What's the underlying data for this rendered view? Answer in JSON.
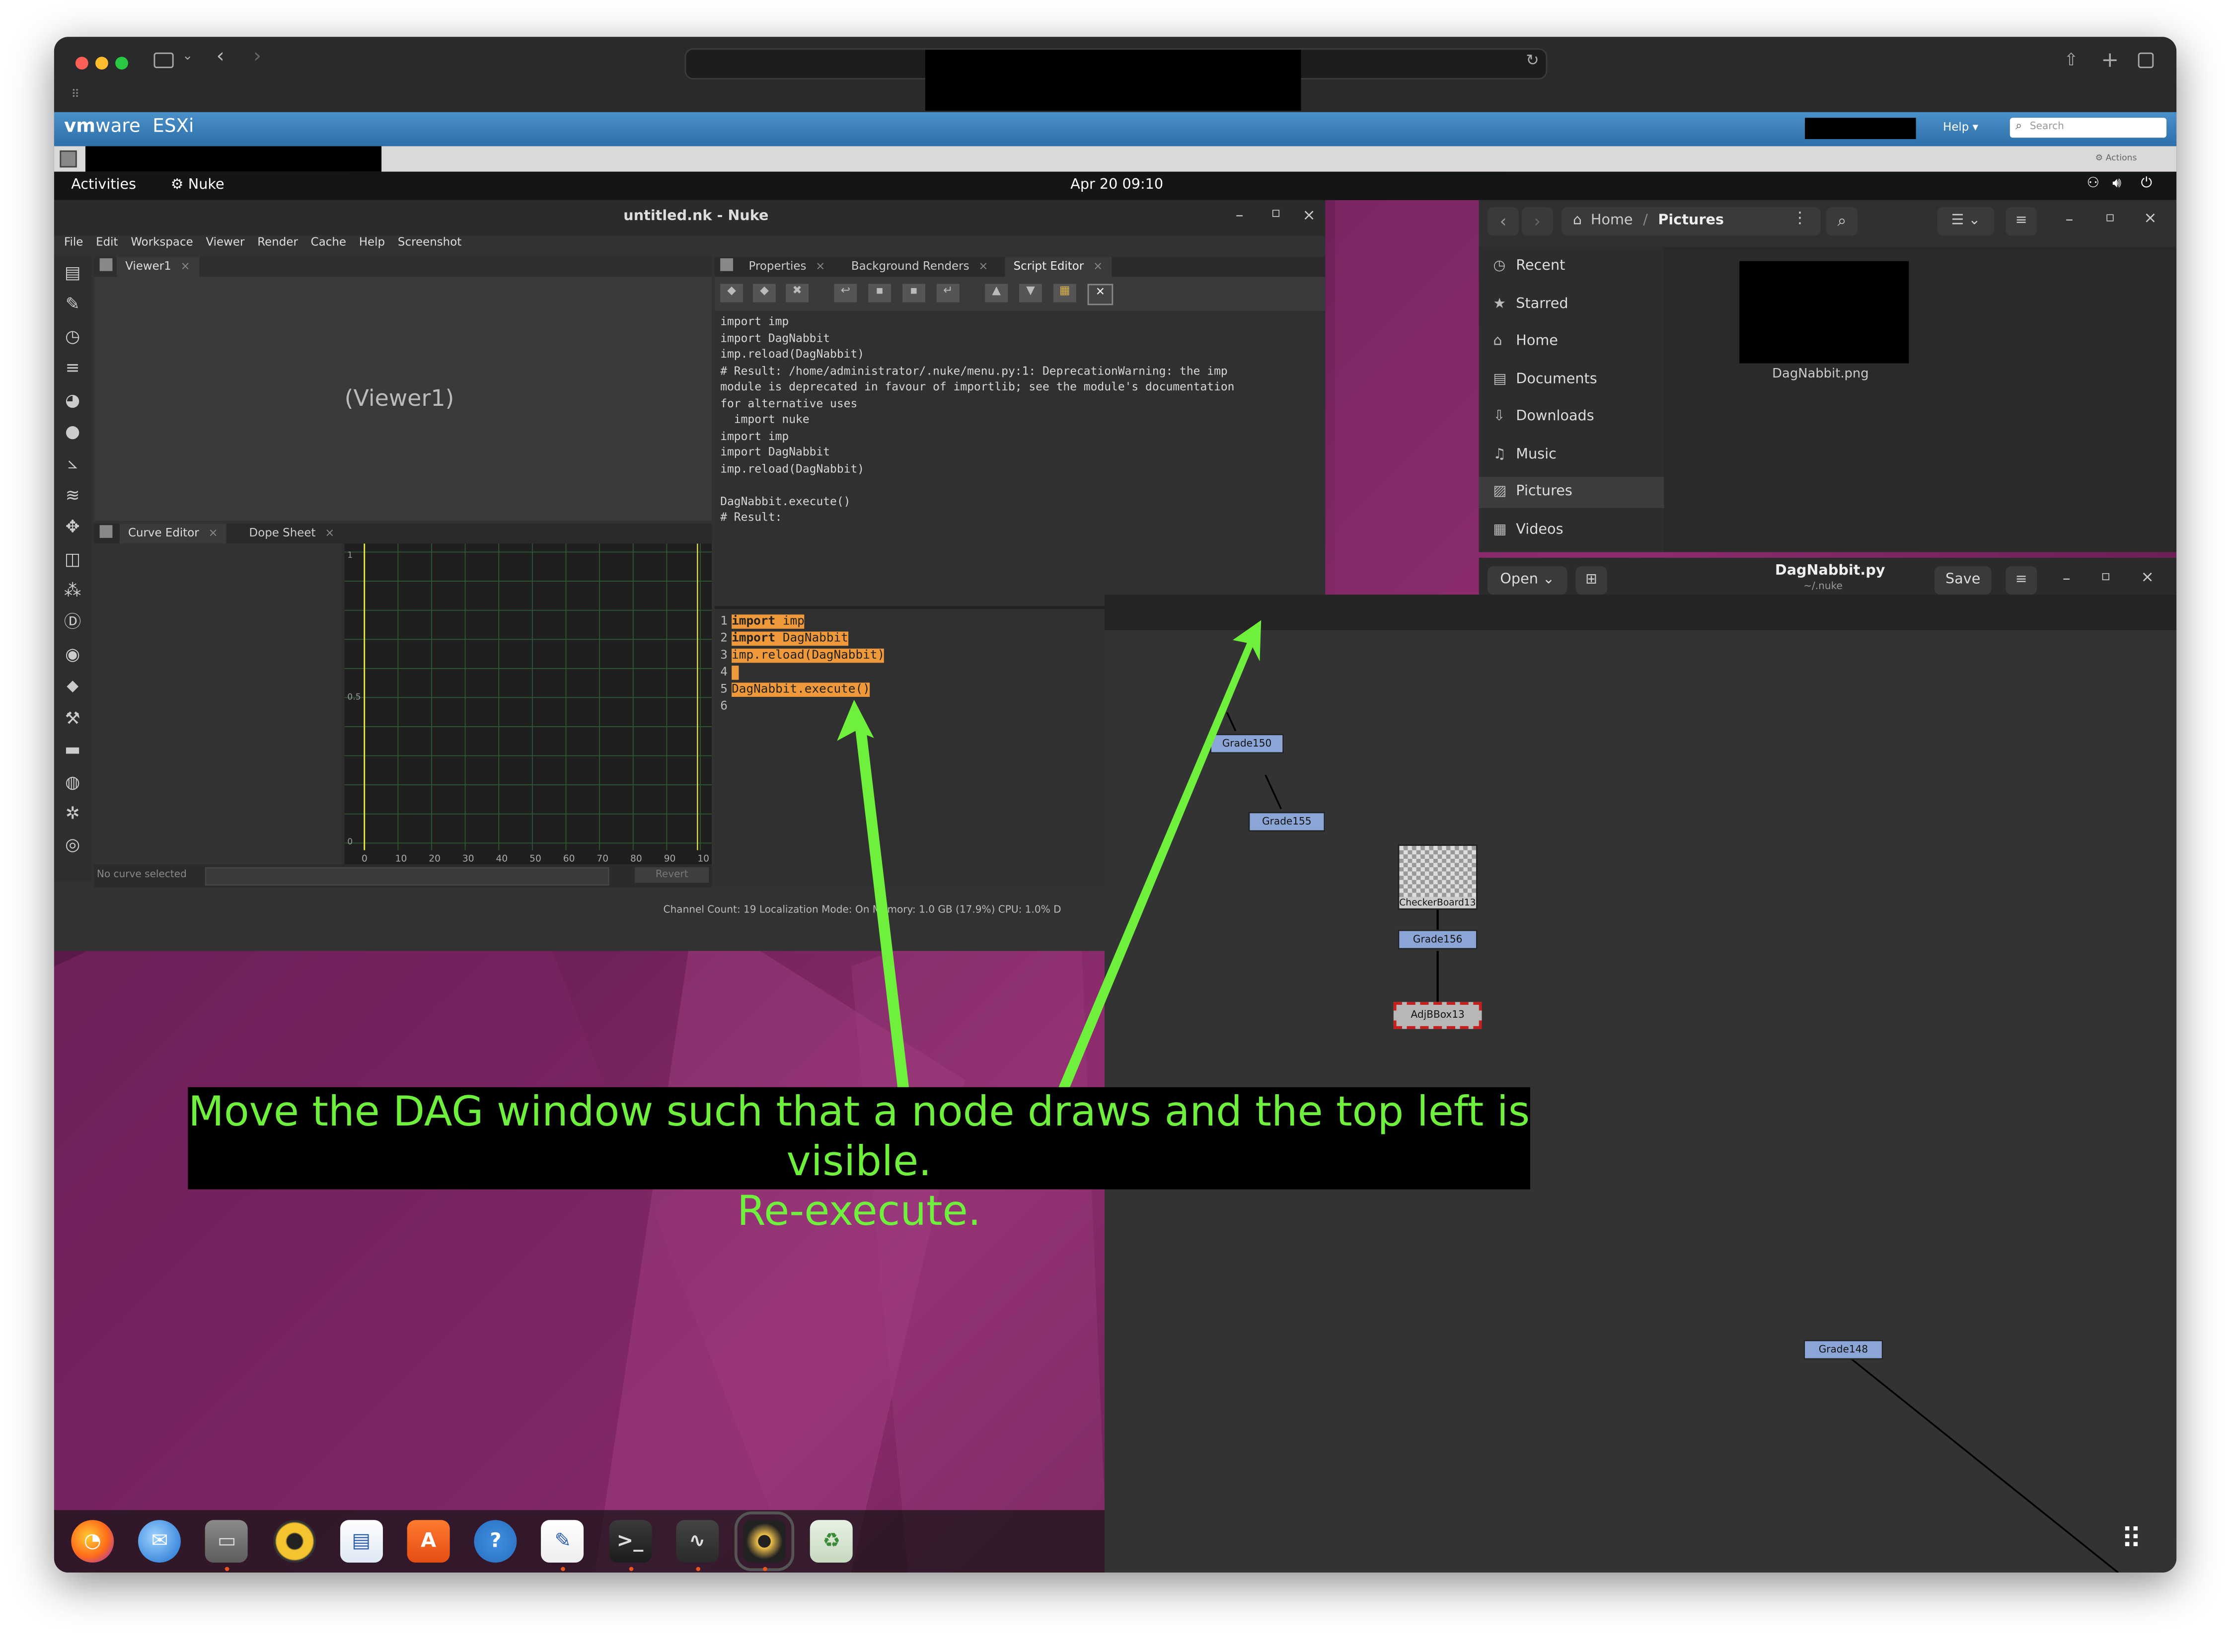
{
  "safari": {
    "url_redacted": true
  },
  "esxi": {
    "brand_vm": "vm",
    "brand_ware": "ware",
    "product": "ESXi",
    "help": "Help ▾",
    "search_placeholder": "Search",
    "actions": "Actions"
  },
  "gnome": {
    "activities": "Activities",
    "app": "Nuke",
    "clock": "Apr 20  09:10"
  },
  "nuke": {
    "title": "untitled.nk - Nuke",
    "menu": [
      "File",
      "Edit",
      "Workspace",
      "Viewer",
      "Render",
      "Cache",
      "Help",
      "Screenshot"
    ],
    "viewer_tab": "Viewer1",
    "viewer_label": "(Viewer1)",
    "curve_tab": "Curve Editor",
    "dope_tab": "Dope Sheet",
    "no_curve": "No curve selected",
    "revert": "Revert",
    "curve_y": [
      "1",
      "0.5",
      "0"
    ],
    "curve_x": [
      "0",
      "10",
      "20",
      "30",
      "40",
      "50",
      "60",
      "70",
      "80",
      "90",
      "10"
    ],
    "tabs": [
      "Properties",
      "Background Renders",
      "Script Editor"
    ],
    "output": "import imp\nimport DagNabbit\nimp.reload(DagNabbit)\n# Result: /home/administrator/.nuke/menu.py:1: DeprecationWarning: the imp\nmodule is deprecated in favour of importlib; see the module's documentation\nfor alternative uses\n  import nuke\nimport imp\nimport DagNabbit\nimp.reload(DagNabbit)\n\nDagNabbit.execute()\n# Result:",
    "code_lines": [
      {
        "n": "1",
        "kw": "import",
        "rest": " imp"
      },
      {
        "n": "2",
        "kw": "import",
        "rest": " DagNabbit"
      },
      {
        "n": "3",
        "kw": "",
        "rest": "imp.reload(DagNabbit)"
      },
      {
        "n": "4",
        "kw": "",
        "rest": ""
      },
      {
        "n": "5",
        "kw": "",
        "rest": "DagNabbit.execute()"
      },
      {
        "n": "6",
        "kw": "",
        "rest": ""
      }
    ],
    "status": "Channel Count: 19  Localization Mode: On  Memory: 1.0 GB (17.9%)  CPU: 1.0%  D"
  },
  "files": {
    "path_home": "Home",
    "path_sep": "/",
    "path_current": "Pictures",
    "sidebar": [
      "Recent",
      "Starred",
      "Home",
      "Documents",
      "Downloads",
      "Music",
      "Pictures",
      "Videos"
    ],
    "active": "Pictures",
    "file_name": "DagNabbit.png"
  },
  "editor": {
    "open": "Open",
    "title": "DagNabbit.py",
    "subtitle": "~/.nuke",
    "save": "Save"
  },
  "dag": {
    "nodes": [
      "Grade150",
      "Grade155",
      "CheckerBoard13",
      "Grade156",
      "AdjBBox13",
      "Grade148"
    ]
  },
  "annotation": {
    "line1": "Move the DAG window such that a node draws and the top left is visible.",
    "line2": "Re-execute.",
    "color": "#6ef03c"
  },
  "dock": [
    "firefox-icon",
    "thunderbird-icon",
    "files-icon",
    "rhythmbox-icon",
    "writer-icon",
    "app-center-icon",
    "help-icon",
    "text-editor-icon",
    "terminal-icon",
    "system-monitor-icon",
    "nuke-icon",
    "trash-icon"
  ]
}
